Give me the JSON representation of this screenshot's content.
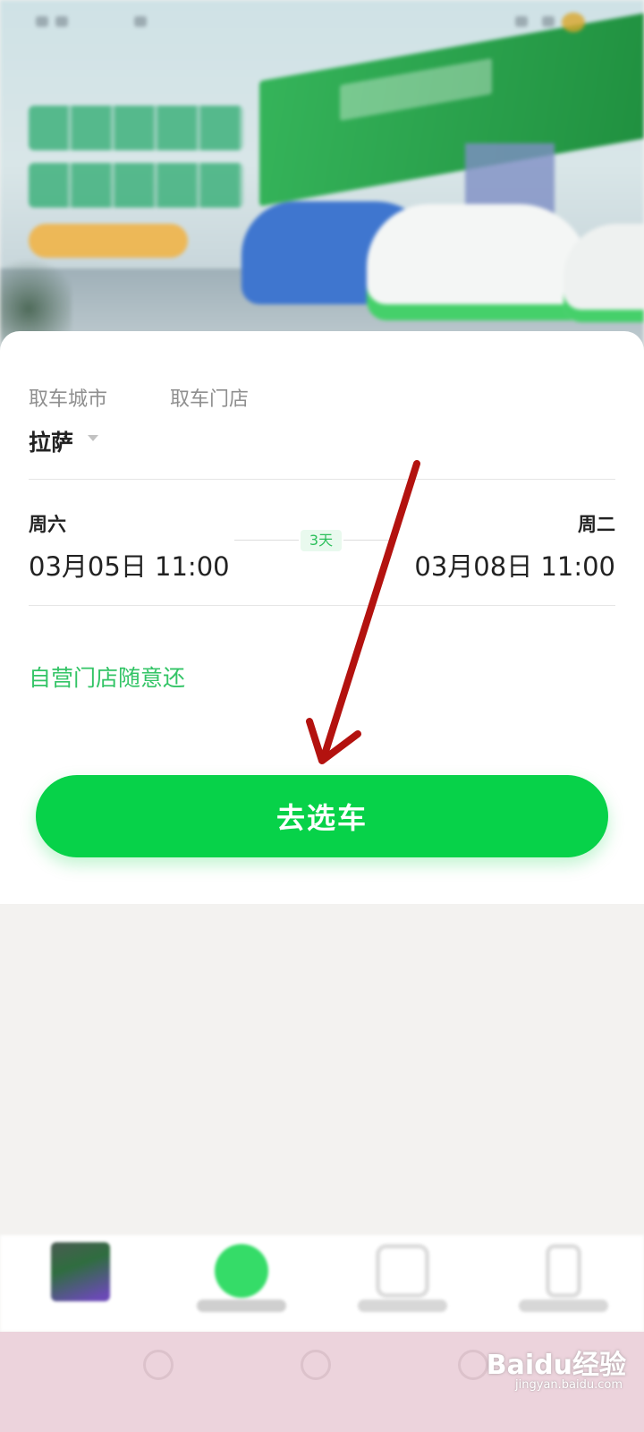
{
  "hero": {
    "icons": [
      "status-bar",
      "promo-banner",
      "car-illustration"
    ]
  },
  "booking": {
    "pickup_city_label": "取车城市",
    "pickup_store_label": "取车门店",
    "pickup_city_value": "拉萨",
    "pickup_weekday": "周六",
    "pickup_datetime": "03月05日 11:00",
    "return_weekday": "周二",
    "return_datetime": "03月08日 11:00",
    "duration": "3天",
    "return_note": "自营门店随意还",
    "go_button_label": "去选车"
  },
  "colors": {
    "accent_green": "#07d249",
    "note_green": "#33c466",
    "annotation_arrow": "#b3120f"
  },
  "tabbar": {
    "icons": [
      "home-tab-icon",
      "rent-tab-icon",
      "orders-tab-icon",
      "profile-tab-icon"
    ]
  },
  "watermark": {
    "logo": "Baidu经验",
    "url": "jingyan.baidu.com"
  }
}
